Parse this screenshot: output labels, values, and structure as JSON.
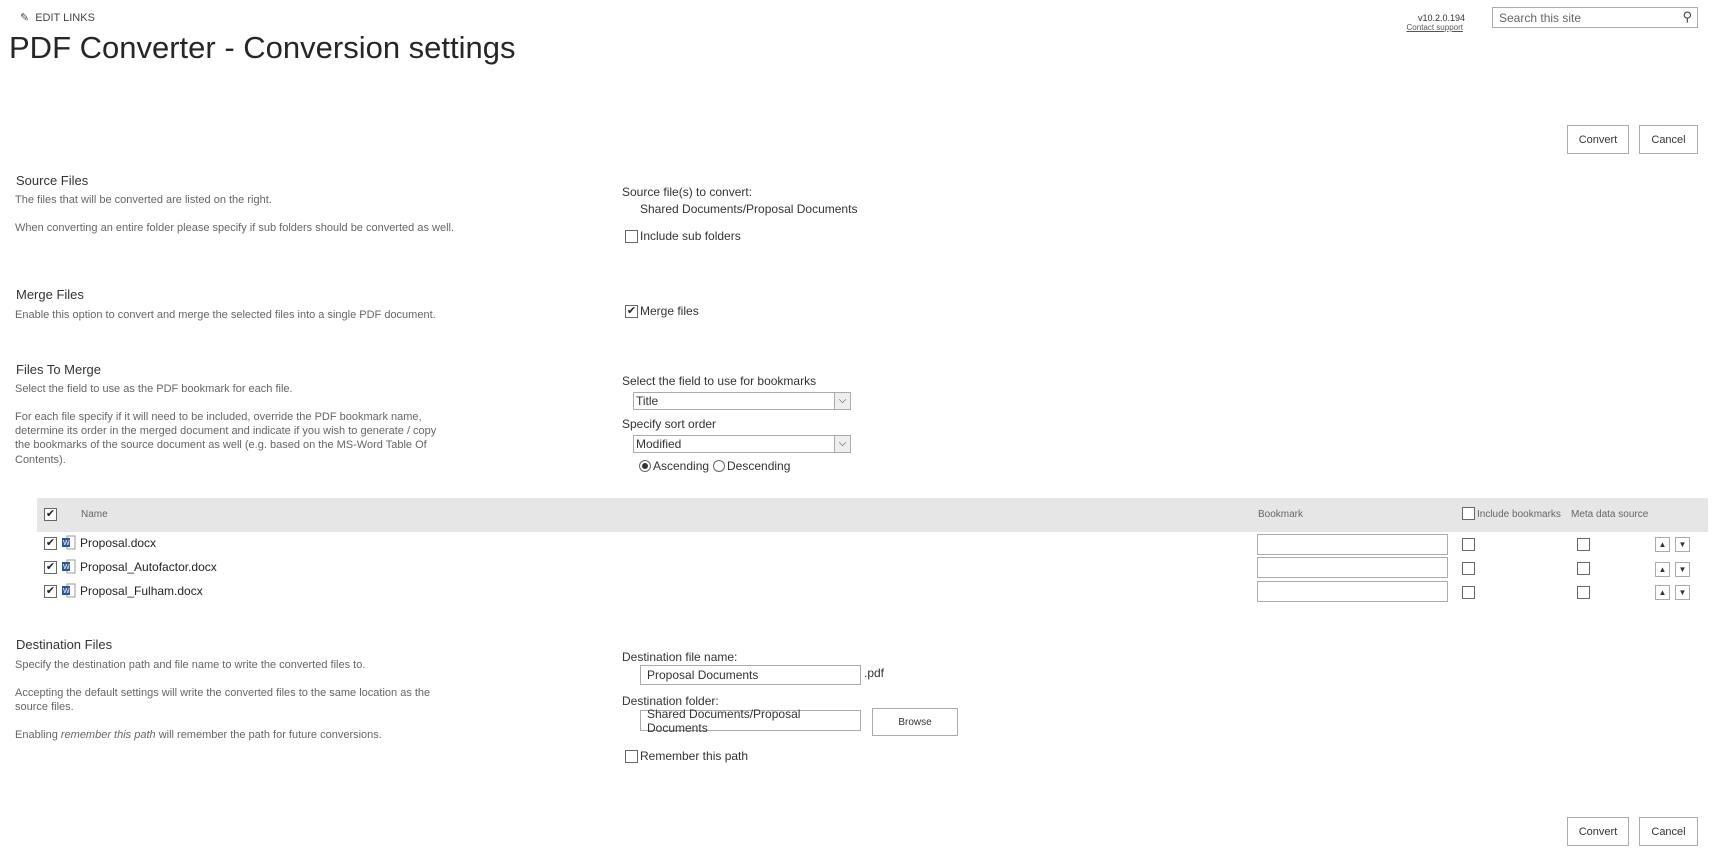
{
  "header": {
    "edit_links": "EDIT LINKS",
    "title": "PDF Converter - Conversion settings",
    "version": "v10.2.0.194",
    "contact": "Contact support",
    "search_placeholder": "Search this site"
  },
  "buttons": {
    "convert": "Convert",
    "cancel": "Cancel",
    "browse": "Browse"
  },
  "source": {
    "heading": "Source Files",
    "desc1": "The files that will be converted are listed on the right.",
    "desc2": "When converting an entire folder please specify if sub folders should be converted as well.",
    "label": "Source file(s) to convert:",
    "path": "Shared Documents/Proposal Documents",
    "include_sub": "Include sub folders",
    "include_sub_checked": false
  },
  "merge": {
    "heading": "Merge Files",
    "desc": "Enable this option to convert and merge the selected files into a single PDF document.",
    "label": "Merge files",
    "checked": true
  },
  "files_to_merge": {
    "heading": "Files To Merge",
    "desc1": "Select the field to use as the PDF bookmark for each file.",
    "desc2_l1": "For each file specify if it will need to be included, override the PDF bookmark name,",
    "desc2_l2": "determine its order in the merged document and indicate if you wish to generate / copy",
    "desc2_l3": "the bookmarks of the source document as well (e.g. based on the MS-Word Table Of",
    "desc2_l4": "Contents).",
    "bookmark_field_label": "Select the field to use for bookmarks",
    "bookmark_field_value": "Title",
    "sort_label": "Specify sort order",
    "sort_value": "Modified",
    "ascending": "Ascending",
    "descending": "Descending",
    "sort_direction": "Ascending"
  },
  "table": {
    "col_name": "Name",
    "col_bookmark": "Bookmark",
    "col_include": "Include bookmarks",
    "col_meta": "Meta data source",
    "rows": [
      {
        "name": "Proposal.docx",
        "checked": true,
        "bookmark": ""
      },
      {
        "name": "Proposal_Autofactor.docx",
        "checked": true,
        "bookmark": ""
      },
      {
        "name": "Proposal_Fulham.docx",
        "checked": true,
        "bookmark": ""
      }
    ]
  },
  "destination": {
    "heading": "Destination Files",
    "desc1": "Specify the destination path and file name to write the converted files to.",
    "desc2_l1": "Accepting the default settings will write the converted files to the same location as the",
    "desc2_l2": "source files.",
    "desc3_pre": "Enabling ",
    "desc3_em": "remember this path",
    "desc3_post": " will remember the path for future conversions.",
    "file_label": "Destination file name:",
    "file_value": "Proposal Documents",
    "ext": ".pdf",
    "folder_label": "Destination folder:",
    "folder_value": "Shared Documents/Proposal Documents",
    "remember": "Remember this path",
    "remember_checked": false
  }
}
